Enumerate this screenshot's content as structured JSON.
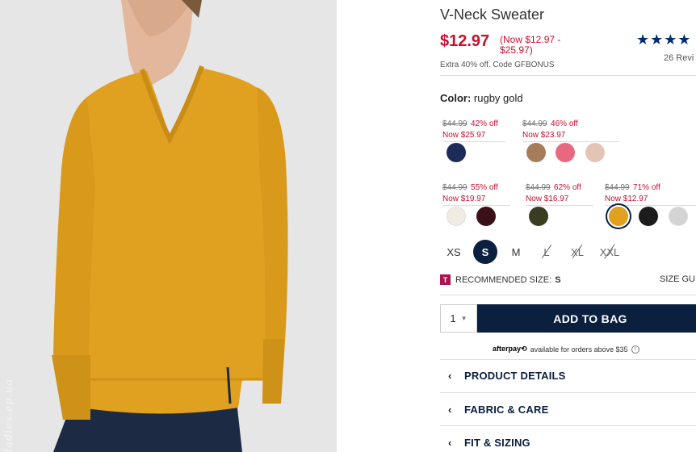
{
  "product": {
    "title": "V-Neck Sweater",
    "price": "$12.97",
    "price_range": "(Now $12.97 - $25.97)",
    "stars": "★★★★",
    "reviews": "26 Revi",
    "promo": "Extra 40% off. Code GFBONUS",
    "watermark": "ladies.ep.ua"
  },
  "color": {
    "label": "Color:",
    "value": "rugby gold"
  },
  "price_groups": [
    {
      "original": "$44.99",
      "discount": "42% off",
      "now": "Now $25.97"
    },
    {
      "original": "$44.99",
      "discount": "46% off",
      "now": "Now $23.97"
    },
    {
      "original": "$44.99",
      "discount": "55% off",
      "now": "Now $19.97"
    },
    {
      "original": "$44.99",
      "discount": "62% off",
      "now": "Now $16.97"
    },
    {
      "original": "$44.99",
      "discount": "71% off",
      "now": "Now $12.97"
    }
  ],
  "swatches": [
    {
      "name": "navy",
      "color": "#1c2b5a"
    },
    {
      "name": "brown",
      "color": "#a67c5b"
    },
    {
      "name": "pink",
      "color": "#e8687f"
    },
    {
      "name": "blush",
      "color": "#e3c5b6"
    },
    {
      "name": "cream",
      "color": "#f0ece4"
    },
    {
      "name": "burgundy",
      "color": "#3b1118"
    },
    {
      "name": "olive",
      "color": "#3a3d22"
    },
    {
      "name": "rugby-gold",
      "color": "#e0a020"
    },
    {
      "name": "black",
      "color": "#1c1c1c"
    },
    {
      "name": "light-grey",
      "color": "#d4d4d4"
    }
  ],
  "sizes": [
    {
      "label": "XS",
      "state": "available"
    },
    {
      "label": "S",
      "state": "selected"
    },
    {
      "label": "M",
      "state": "available"
    },
    {
      "label": "L",
      "state": "unavailable"
    },
    {
      "label": "XL",
      "state": "unavailable"
    },
    {
      "label": "XXL",
      "state": "unavailable"
    }
  ],
  "recommended": {
    "icon": "T",
    "label": "RECOMMENDED SIZE:",
    "value": "S",
    "size_guide": "SIZE GU"
  },
  "cart": {
    "quantity": "1",
    "add_to_bag": "ADD TO BAG"
  },
  "afterpay": {
    "logo": "afterpay⟲",
    "text": "available for orders above $35",
    "info": "i"
  },
  "accordions": [
    {
      "label": "PRODUCT DETAILS"
    },
    {
      "label": "FABRIC & CARE"
    },
    {
      "label": "FIT & SIZING"
    }
  ],
  "colors": {
    "sale_red": "#c8102e",
    "navy_brand": "#0b1f3f",
    "sweater": "#e0a020"
  }
}
